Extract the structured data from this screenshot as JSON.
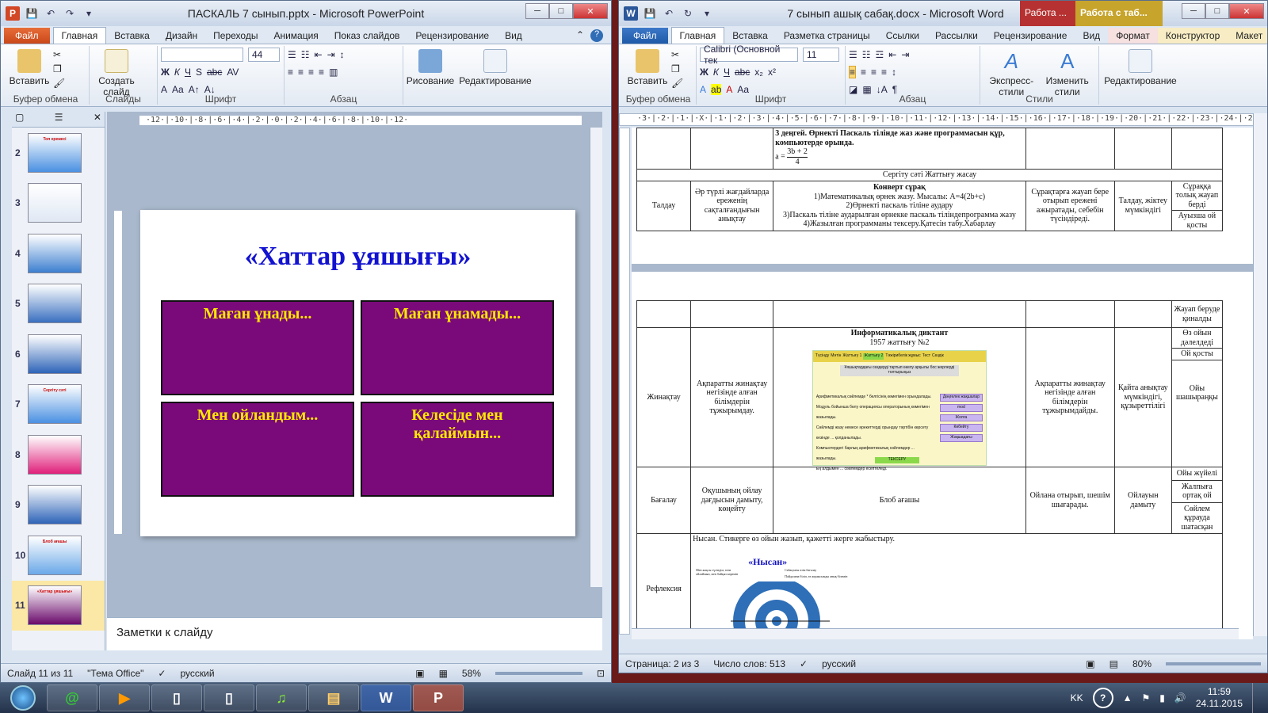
{
  "ppt": {
    "title": "ПАСКАЛЬ 7 сынып.pptx - Microsoft PowerPoint",
    "tabs": [
      "Файл",
      "Главная",
      "Вставка",
      "Дизайн",
      "Переходы",
      "Анимация",
      "Показ слайдов",
      "Рецензирование",
      "Вид"
    ],
    "ribbon": {
      "paste": "Вставить",
      "new_slide": "Создать слайд",
      "font_size": "44",
      "drawing": "Рисование",
      "editing": "Редактирование",
      "groups": [
        "Буфер обмена",
        "Слайды",
        "Шрифт",
        "Абзац"
      ]
    },
    "ruler": "·12·|·10·|·8·|·6·|·4·|·2·|·0·|·2·|·4·|·6·|·8·|·10·|·12·",
    "slide_numbers": [
      "2",
      "3",
      "4",
      "5",
      "6",
      "7",
      "8",
      "9",
      "10",
      "11"
    ],
    "thumb_titles": [
      "Топ ережесі",
      "",
      "",
      "",
      "",
      "Сергіту сәті",
      "",
      "",
      "Блоб ағашы",
      "«Хаттар ұяшығы»"
    ],
    "slide": {
      "title": "«Хаттар ұяшығы»",
      "cells": [
        "Маған ұнады...",
        "Маған ұнамады...",
        "Мен ойландым...",
        "Келесіде мен қалаймын..."
      ]
    },
    "notes_placeholder": "Заметки к слайду",
    "status": {
      "slide": "Слайд 11 из 11",
      "theme": "\"Тема Office\"",
      "lang": "русский",
      "zoom": "58%"
    }
  },
  "word": {
    "title": "7 сынып ашық сабақ.docx - Microsoft Word",
    "ctx_tab1": "Работа ...",
    "ctx_tab2": "Работа с таб...",
    "tabs": [
      "Файл",
      "Главная",
      "Вставка",
      "Разметка страницы",
      "Ссылки",
      "Рассылки",
      "Рецензирование",
      "Вид",
      "Формат",
      "Конструктор",
      "Макет"
    ],
    "ribbon": {
      "font": "Calibri (Основной тек",
      "size": "11",
      "paste": "Вставить",
      "styles": "Экспресс-стили",
      "change_styles": "Изменить стили",
      "editing": "Редактирование",
      "groups": [
        "Буфер обмена",
        "Шрифт",
        "Абзац",
        "Стили"
      ]
    },
    "ruler": "·3·|·2·|·1·|·X·|·1·|·2·|·3·|·4·|·5·|·6·|·7·|·8·|·9·|·10·|·11·|·12·|·13·|·14·|·15·|·16·|·17·|·18·|·19·|·20·|·21·|·22·|·23·|·24·|·25",
    "doc": {
      "level3": "3 деңгей. Өрнекті Паскаль тілінде жаз және программасын құр, компьютерде орында.",
      "formula_a": "a =",
      "formula_num": "3b + 2",
      "formula_den": "4",
      "sergitu": "Сергіту сәті Жаттығу жасау",
      "taldau": "Талдау",
      "taldau_goal": "Әр түрлі жағдайларда ереженің сақталғандығын анықтау",
      "konvert_title": "Конверт сұрақ",
      "konvert_lines": [
        "1)Математикалық өрнек жазу. Мысалы: A=4(2b+c)",
        "2)Өрнекті паскаль тіліне аудару",
        "3)Паскаль тіліне аударылған өрнекке паскаль тіліндепрограмма жазу",
        "4)Жазылған программаны тексеру.Қатесін табу.Хабарлау"
      ],
      "taldau_result": "Сұрақтарға жауап бере отырып ережені ажыратады, себебін түсіндіреді.",
      "taldau_skill": "Талдау, жіктеу мүмкіндігі",
      "taldau_r1": "Сұраққа толық жауап берді",
      "taldau_r2": "Ауызша ой қосты",
      "right_a": "Жауап беруде қиналды",
      "right_b": "Өз ойын дәлелдеді",
      "right_c": "Ой қосты",
      "zhinaktau": "Жинақтау",
      "zh_goal": "Ақпаратты жинақтау негізінде алған білімдерін тұжырымдау.",
      "dict_title": "Информатикалық диктант",
      "dict_sub": "1957 жаттығу №2",
      "inner_tabs": [
        "Түсінду",
        "Мәтін",
        "Жаттығу 1",
        "Жаттығу 2",
        "Тәжірибелік жұмыс",
        "Тест",
        "Сөздік"
      ],
      "inner_header": "Ұяшықтардағы сөздерді тартып өкелу арқылы бос жерлерді толтырыңыз",
      "inner_lines": [
        "Арифметикалық сөйлемде * белгісінің көмегімен орындалады.",
        "Модуль бойынша бөлу операциясы операторының көмегімен жазылады.",
        "Сөйлемді жазу немесе әрекеттерді орындау тәртібін көрсету кезінде ... қолданылады.",
        "Компьютердегі барлық арифметикалық сөйлемдер ... жазылады.",
        "Ең алдымен ... сөйлемдер есептеледі."
      ],
      "inner_options": [
        "Дөңгелек жақшалар",
        "mod",
        "Жолға",
        "Көбейту",
        "Жақшадағы"
      ],
      "inner_check": "ТЕКСЕРУ",
      "zh_result": "Ақпаратты жинақтау негізінде алған білімдерін тұжырымдайды.",
      "zh_skill": "Қайта анықтау мүмкіндігі, құзыреттілігі",
      "zh_r1": "Ойы шашыраңқы",
      "bagalau": "Бағалау",
      "bag_goal": "Оқушының ойлау дағдысын дамыту, көңейту",
      "bag_act": "Блоб ағашы",
      "bag_result": "Ойлана отырып, шешім шығарады.",
      "bag_skill": "Ойлауын дамыту",
      "bag_r1": "Ойы жүйелі",
      "bag_r2": "Жалпыға ортақ ой",
      "bag_r3": "Сөйлем құрауда шатасқан",
      "reflexia": "Рефлексия",
      "nysan_intro": "Нысан. Стикерге өз ойын жазып, қажетті жерге жабыстыру.",
      "nysan_title": "«Нысан»",
      "nysan_l1": "Мен жақсы түсіндім, өзім ойлаймын, мен байқап көремін",
      "nysan_l2": "Сабақтағы өзім бағалау",
      "nysan_l3": "Пайдалана біліп, өз жұмысымды анық білемін"
    },
    "status": {
      "page": "Страница: 2 из 3",
      "words": "Число слов: 513",
      "lang": "русский",
      "zoom": "80%"
    }
  },
  "taskbar": {
    "lang": "KK",
    "time": "11:59",
    "date": "24.11.2015"
  }
}
